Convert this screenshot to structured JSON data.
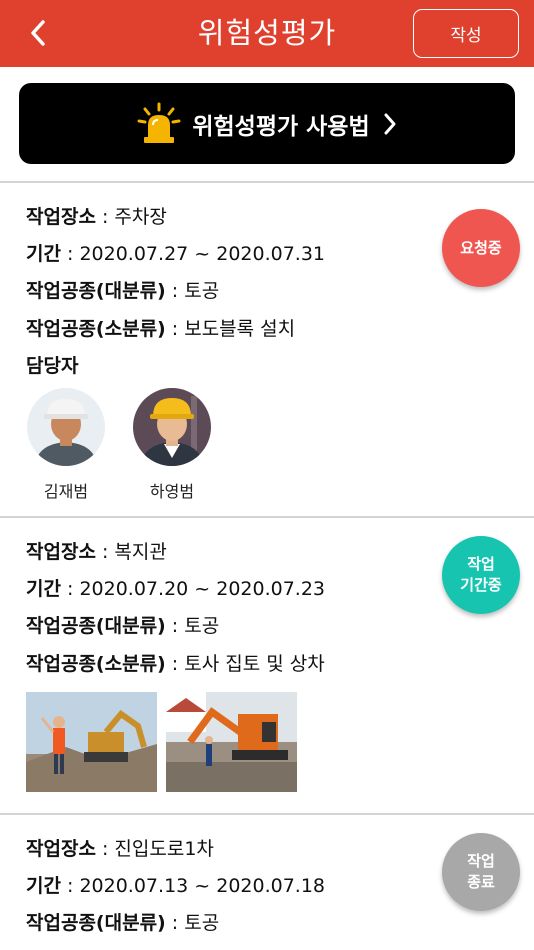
{
  "header": {
    "title": "위험성평가",
    "write_label": "작성"
  },
  "guide": {
    "label": "위험성평가 사용법"
  },
  "cards": [
    {
      "location_label": "작업장소",
      "location": "주차장",
      "period_label": "기간",
      "period": "2020.07.27 ~ 2020.07.31",
      "major_label": "작업공종(대분류)",
      "major": "토공",
      "minor_label": "작업공종(소분류)",
      "minor": "보도블록 설치",
      "manager_label": "담당자",
      "managers": [
        {
          "name": "김재범"
        },
        {
          "name": "하영범"
        }
      ],
      "status_line1": "요청중",
      "status_line2": ""
    },
    {
      "location_label": "작업장소",
      "location": "복지관",
      "period_label": "기간",
      "period": "2020.07.20 ~ 2020.07.23",
      "major_label": "작업공종(대분류)",
      "major": "토공",
      "minor_label": "작업공종(소분류)",
      "minor": "토사 집토 및 상차",
      "status_line1": "작업",
      "status_line2": "기간중"
    },
    {
      "location_label": "작업장소",
      "location": "진입도로1차",
      "period_label": "기간",
      "period": "2020.07.13 ~ 2020.07.18",
      "major_label": "작업공종(대분류)",
      "major": "토공",
      "status_line1": "작업",
      "status_line2": "종료"
    }
  ],
  "colors": {
    "header": "#e0402e",
    "requesting": "#f05650",
    "in_progress": "#17c4b0",
    "ended": "#a8a8a8"
  },
  "icons": {
    "back": "chevron-left-icon",
    "guide": "siren-icon",
    "guide_arrow": "chevron-right-icon"
  }
}
